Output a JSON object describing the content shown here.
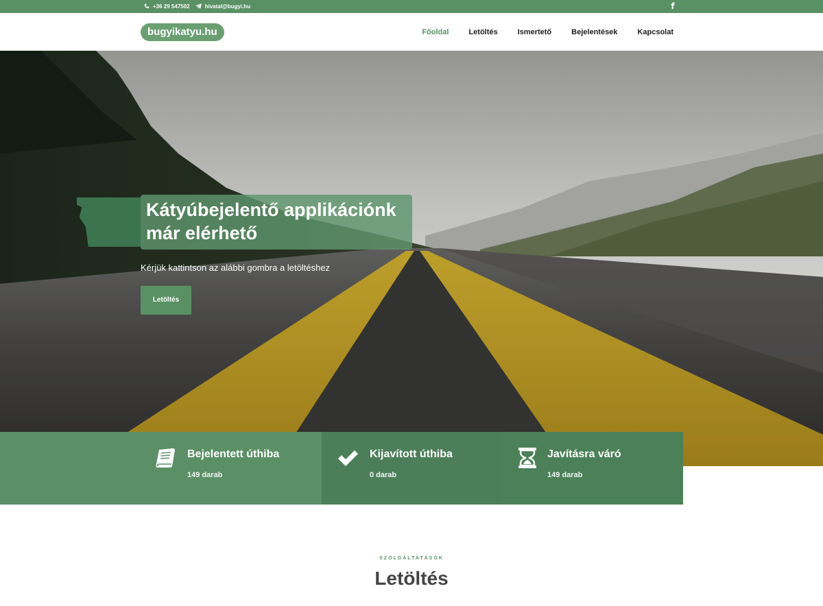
{
  "topbar": {
    "phone": "+36 29 547502",
    "email": "hivatal@bugyi.hu",
    "phone_icon": "phone-icon",
    "email_icon": "send-icon",
    "social_icon": "facebook-icon"
  },
  "header": {
    "logo": "bugyikatyu.hu",
    "nav": [
      {
        "label": "Főoldal",
        "active": true
      },
      {
        "label": "Letöltés",
        "active": false
      },
      {
        "label": "Ismertető",
        "active": false
      },
      {
        "label": "Bejelentések",
        "active": false
      },
      {
        "label": "Kapcsolat",
        "active": false
      }
    ]
  },
  "hero": {
    "headline": "Kátyúbejelentő applikációnk már elérhető",
    "subtitle": "Kérjük kattintson az alábbi gombra a letöltéshez",
    "button": "Letöltés"
  },
  "stats": [
    {
      "icon": "book-icon",
      "title": "Bejelentett úthiba",
      "count": "149 darab"
    },
    {
      "icon": "checkmark-icon",
      "title": "Kijavított úthiba",
      "count": "0 darab"
    },
    {
      "icon": "hourglass-icon",
      "title": "Javításra váró",
      "count": "149 darab"
    }
  ],
  "services": {
    "kicker": "SZOLGÁLTATÁSOK",
    "title": "Letöltés"
  },
  "colors": {
    "brand_green": "#5a9164",
    "road_yellow": "#c9a227"
  }
}
